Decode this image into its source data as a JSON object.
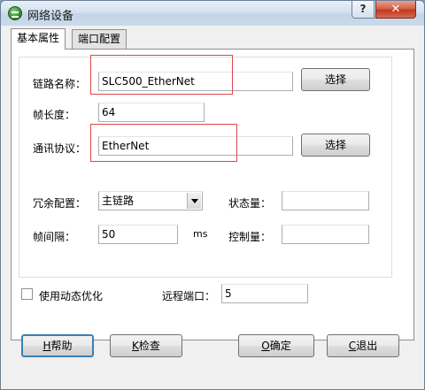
{
  "window": {
    "title": "网络设备",
    "help_glyph": "?",
    "close_glyph": "✕"
  },
  "tabs": [
    {
      "label": "基本属性",
      "active": true
    },
    {
      "label": "端口配置",
      "active": false
    }
  ],
  "form": {
    "link_name": {
      "label": "链路名称：",
      "value": "SLC500_EtherNet",
      "button": "选择"
    },
    "frame_length": {
      "label": "帧长度：",
      "value": "64"
    },
    "protocol": {
      "label": "通讯协议：",
      "value": "EtherNet",
      "button": "选择"
    },
    "redundancy": {
      "label": "冗余配置：",
      "selected": "主链路"
    },
    "state_var": {
      "label": "状态量：",
      "value": ""
    },
    "frame_interval": {
      "label": "帧间隔：",
      "value": "50",
      "unit": "ms"
    },
    "control_var": {
      "label": "控制量：",
      "value": ""
    },
    "dynamic_opt": {
      "label": "使用动态优化",
      "checked": false
    },
    "remote_port": {
      "label": "远程端口：",
      "value": "5"
    }
  },
  "buttons": {
    "help": {
      "hotkey": "H",
      "text": "帮助"
    },
    "check": {
      "hotkey": "K",
      "text": "检查"
    },
    "ok": {
      "hotkey": "O",
      "text": "确定"
    },
    "cancel": {
      "hotkey": "C",
      "text": "退出"
    }
  },
  "colors": {
    "highlight_box": "#e0454a",
    "close_button": "#c1391e"
  }
}
